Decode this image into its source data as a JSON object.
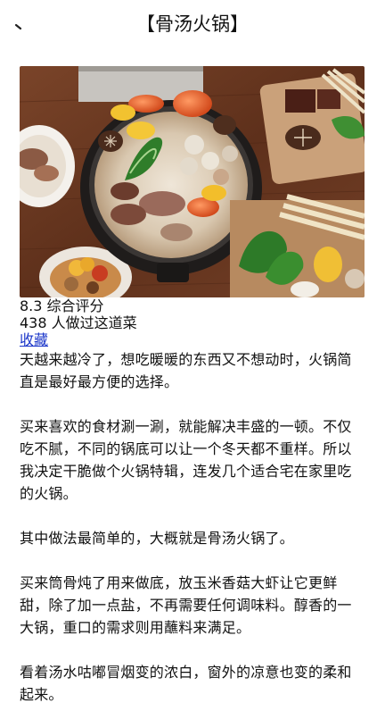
{
  "header": {
    "title": "【骨汤火锅】",
    "back_icon": "back-arrow-icon"
  },
  "recipe": {
    "image_alt": "骨汤火锅",
    "rating_text": "8.3 综合评分",
    "cooked_count_text": "438 人做过这道菜",
    "favorite_label": "收藏"
  },
  "article": {
    "paragraphs": [
      "天越来越冷了，想吃暖暖的东西又不想动时，火锅简直是最好最方便的选择。",
      "买来喜欢的食材涮一涮，就能解决丰盛的一顿。不仅吃不腻，不同的锅底可以让一个冬天都不重样。所以我决定干脆做个火锅特辑，连发几个适合宅在家里吃的火锅。",
      "其中做法最简单的，大概就是骨汤火锅了。",
      "买来筒骨炖了用来做底，放玉米香菇大虾让它更鲜甜，除了加一点盐，不再需要任何调味料。醇香的一大锅，重口的需求则用蘸料来满足。",
      "看着汤水咕嘟冒烟变的浓白，窗外的凉意也变的柔和起来。"
    ]
  },
  "colors": {
    "link": "#1a35c9",
    "text": "#111111",
    "table_wood": "#6b3a22"
  }
}
